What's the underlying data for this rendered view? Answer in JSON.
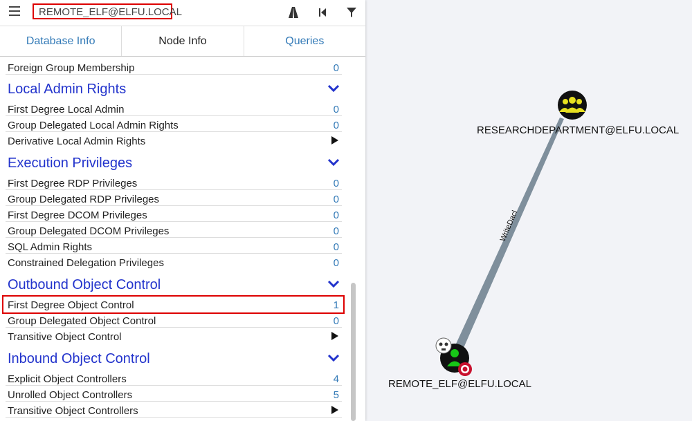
{
  "topbar": {
    "search_value": "REMOTE_ELF@ELFU.LOCAL",
    "icons": [
      "menu-icon",
      "path-icon",
      "back-icon",
      "filter-icon"
    ]
  },
  "tabs": [
    {
      "label": "Database Info",
      "active": false
    },
    {
      "label": "Node Info",
      "active": true
    },
    {
      "label": "Queries",
      "active": false
    }
  ],
  "node_info": {
    "foreign_group_membership": {
      "label": "Foreign Group Membership",
      "value": "0"
    },
    "local_admin": {
      "title": "Local Admin Rights",
      "rows": [
        {
          "label": "First Degree Local Admin",
          "value": "0"
        },
        {
          "label": "Group Delegated Local Admin Rights",
          "value": "0"
        },
        {
          "label": "Derivative Local Admin Rights",
          "value": ""
        }
      ]
    },
    "execution": {
      "title": "Execution Privileges",
      "rows": [
        {
          "label": "First Degree RDP Privileges",
          "value": "0"
        },
        {
          "label": "Group Delegated RDP Privileges",
          "value": "0"
        },
        {
          "label": "First Degree DCOM Privileges",
          "value": "0"
        },
        {
          "label": "Group Delegated DCOM Privileges",
          "value": "0"
        },
        {
          "label": "SQL Admin Rights",
          "value": "0"
        },
        {
          "label": "Constrained Delegation Privileges",
          "value": "0"
        }
      ]
    },
    "outbound": {
      "title": "Outbound Object Control",
      "rows": [
        {
          "label": "First Degree Object Control",
          "value": "1"
        },
        {
          "label": "Group Delegated Object Control",
          "value": "0"
        },
        {
          "label": "Transitive Object Control",
          "value": ""
        }
      ]
    },
    "inbound": {
      "title": "Inbound Object Control",
      "rows": [
        {
          "label": "Explicit Object Controllers",
          "value": "4"
        },
        {
          "label": "Unrolled Object Controllers",
          "value": "5"
        },
        {
          "label": "Transitive Object Controllers",
          "value": ""
        }
      ]
    }
  },
  "graph": {
    "group_node_label": "RESEARCHDEPARTMENT@ELFU.LOCAL",
    "user_node_label": "REMOTE_ELF@ELFU.LOCAL",
    "edge_label": "WriteDacl",
    "colors": {
      "group_node": "#e8e020",
      "user_node": "#17c717",
      "edge": "#7f8f9c",
      "target_badge": "#c8102e"
    }
  }
}
